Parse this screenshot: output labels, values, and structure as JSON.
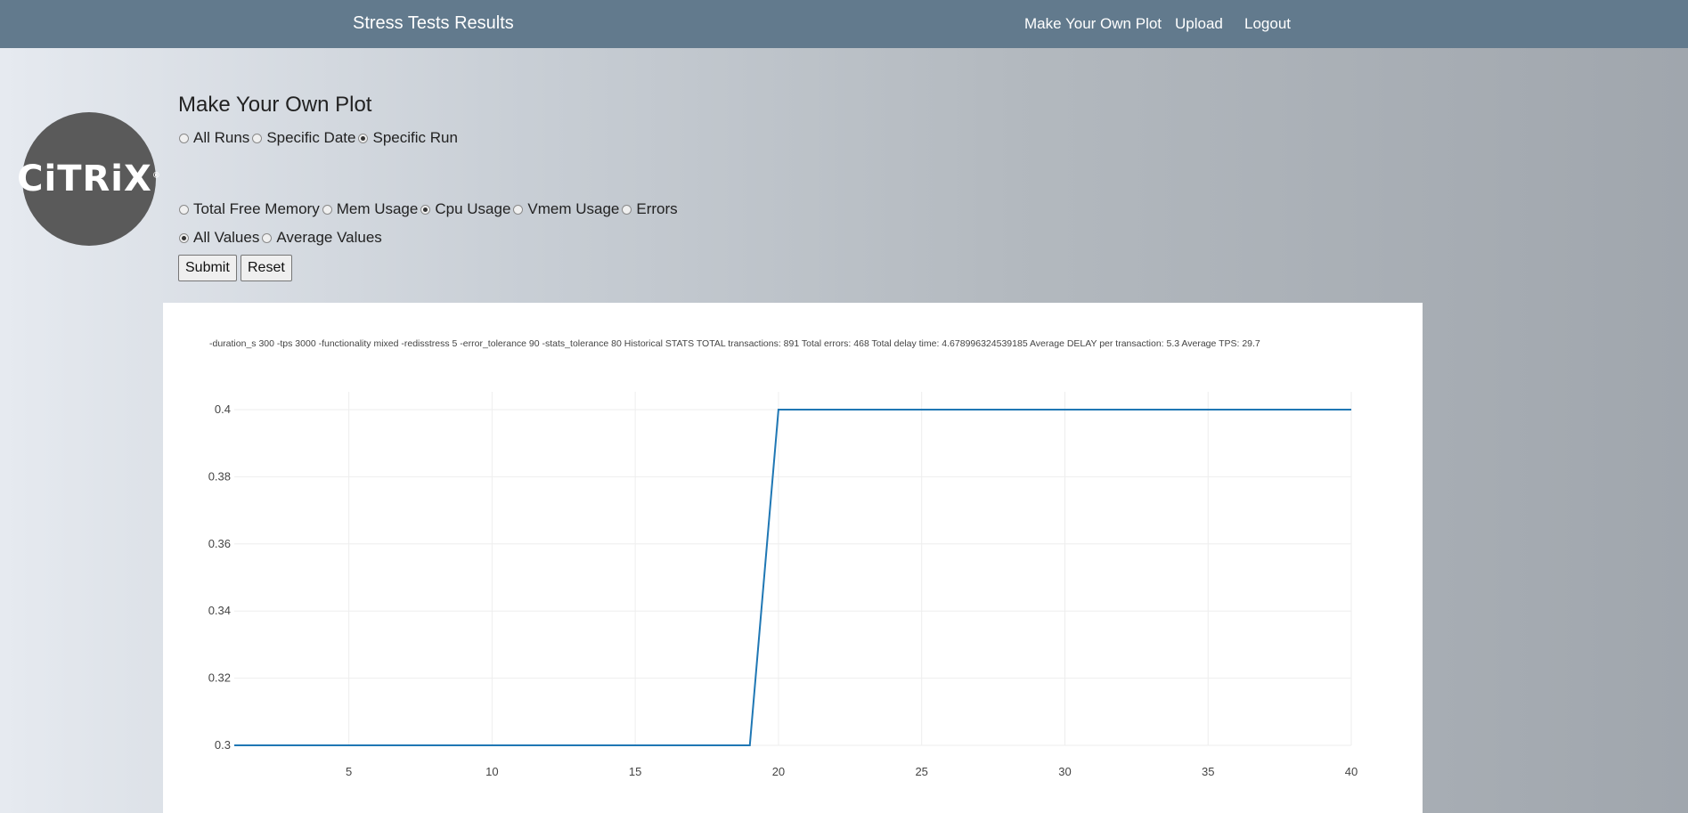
{
  "navbar": {
    "brand": "Stress Tests Results",
    "links": [
      "Make Your Own Plot",
      "Upload",
      "Logout"
    ]
  },
  "logo": {
    "text": "CiTRiX",
    "mark": "®"
  },
  "page_title": "Make Your Own Plot",
  "scope_options": [
    {
      "label": "All Runs",
      "checked": false
    },
    {
      "label": "Specific Date",
      "checked": false
    },
    {
      "label": "Specific Run",
      "checked": true
    }
  ],
  "metric_options": [
    {
      "label": "Total Free Memory",
      "checked": false
    },
    {
      "label": "Mem Usage",
      "checked": false
    },
    {
      "label": "Cpu Usage",
      "checked": true
    },
    {
      "label": "Vmem Usage",
      "checked": false
    },
    {
      "label": "Errors",
      "checked": false
    }
  ],
  "value_options": [
    {
      "label": "All Values",
      "checked": true
    },
    {
      "label": "Average Values",
      "checked": false
    }
  ],
  "buttons": {
    "submit": "Submit",
    "reset": "Reset"
  },
  "run_info": "-duration_s 300 -tps 3000 -functionality mixed -redisstress 5 -error_tolerance 90 -stats_tolerance 80 Historical STATS TOTAL transactions:  891 Total errors:   468 Total delay time:  4.678996324539185 Average DELAY per transaction: 5.3 Average TPS:   29.7",
  "chart_data": {
    "type": "line",
    "x": [
      1,
      19,
      20,
      40
    ],
    "y": [
      0.3,
      0.3,
      0.4,
      0.4
    ],
    "xlim": [
      1,
      40
    ],
    "ylim": [
      0.3,
      0.4
    ],
    "x_ticks": [
      5,
      10,
      15,
      20,
      25,
      30,
      35,
      40
    ],
    "y_ticks": [
      0.3,
      0.32,
      0.34,
      0.36,
      0.38,
      0.4
    ],
    "line_color": "#1f77b4",
    "grid": true
  }
}
